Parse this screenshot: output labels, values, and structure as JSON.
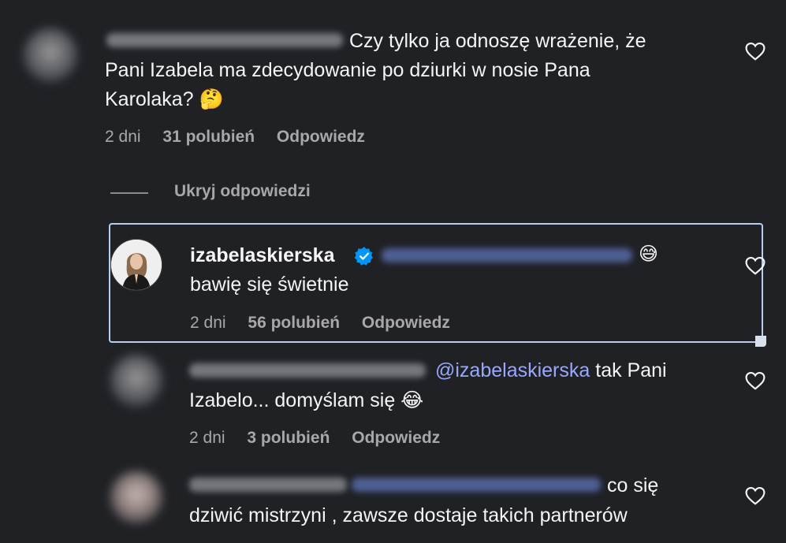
{
  "comment1": {
    "line1": "Czy tylko ja odnoszę wrażenie, że",
    "line2": "Pani Izabela ma zdecydowanie po dziurki w nosie Pana",
    "line3": "Karolaka? 🤔",
    "time": "2 dni",
    "likes": "31 polubień",
    "reply": "Odpowiedz"
  },
  "hide_replies": "Ukryj odpowiedzi",
  "reply1": {
    "username": "izabelaskierska",
    "emoji": "😅",
    "text": "bawię się świetnie",
    "time": "2 dni",
    "likes": "56 polubień",
    "reply": "Odpowiedz"
  },
  "reply2": {
    "mention": "@izabelaskierska",
    "line1_rest": " tak Pani",
    "line2": "Izabelo... domyślam się 😂",
    "time": "2 dni",
    "likes": "3 polubień",
    "reply": "Odpowiedz"
  },
  "reply3": {
    "line1": "co się",
    "line2": "dziwić mistrzyni , zawsze dostaje takich partnerów"
  },
  "colors": {
    "background": "#1f2125",
    "mention": "#98a8ff",
    "highlight_border": "#b8cdf2",
    "verified": "#0095f6"
  },
  "icons": [
    "heart-icon",
    "verified-badge-icon"
  ]
}
